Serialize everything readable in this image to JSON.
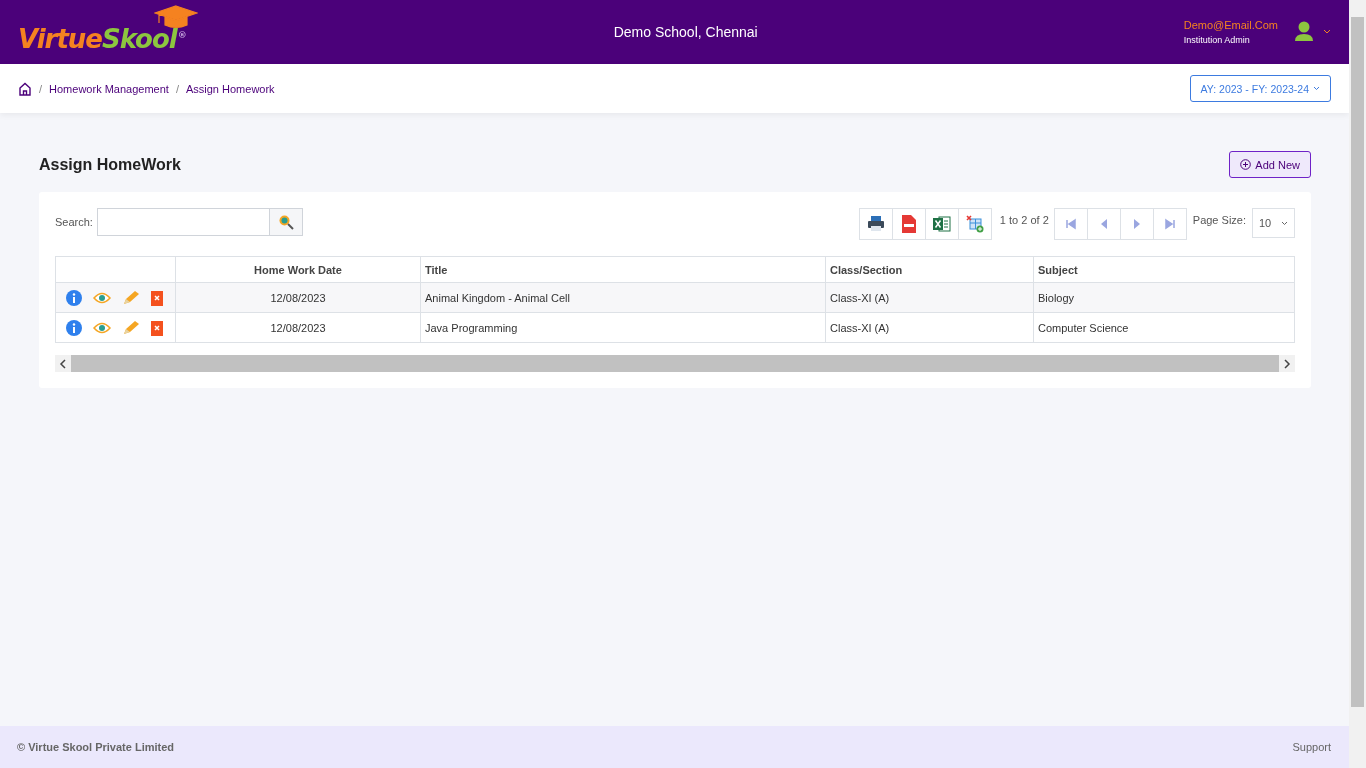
{
  "header": {
    "logo": {
      "first": "Virtue",
      "second": "Skool",
      "mark": "®"
    },
    "school": "Demo School, Chennai",
    "user": {
      "email": "Demo@Email.Com",
      "role": "Institution Admin"
    }
  },
  "breadcrumb": {
    "separator": "/",
    "items": [
      "Homework Management",
      "Assign Homework"
    ]
  },
  "year_selector": {
    "label": "AY: 2023 - FY: 2023-24"
  },
  "page": {
    "title": "Assign HomeWork",
    "add_button": "Add New"
  },
  "toolbar": {
    "search_label": "Search:",
    "range": "1 to 2 of 2",
    "page_size_label": "Page Size:",
    "page_size": "10"
  },
  "table": {
    "columns": [
      "",
      "Home Work Date",
      "Title",
      "Class/Section",
      "Subject"
    ],
    "rows": [
      {
        "date": "12/08/2023",
        "title": "Animal Kingdom - Animal Cell",
        "class": "Class-XI (A)",
        "subject": "Biology"
      },
      {
        "date": "12/08/2023",
        "title": "Java Programming",
        "class": "Class-XI (A)",
        "subject": "Computer Science"
      }
    ]
  },
  "footer": {
    "copyright": "© Virtue Skool Private Limited",
    "support": "Support"
  }
}
